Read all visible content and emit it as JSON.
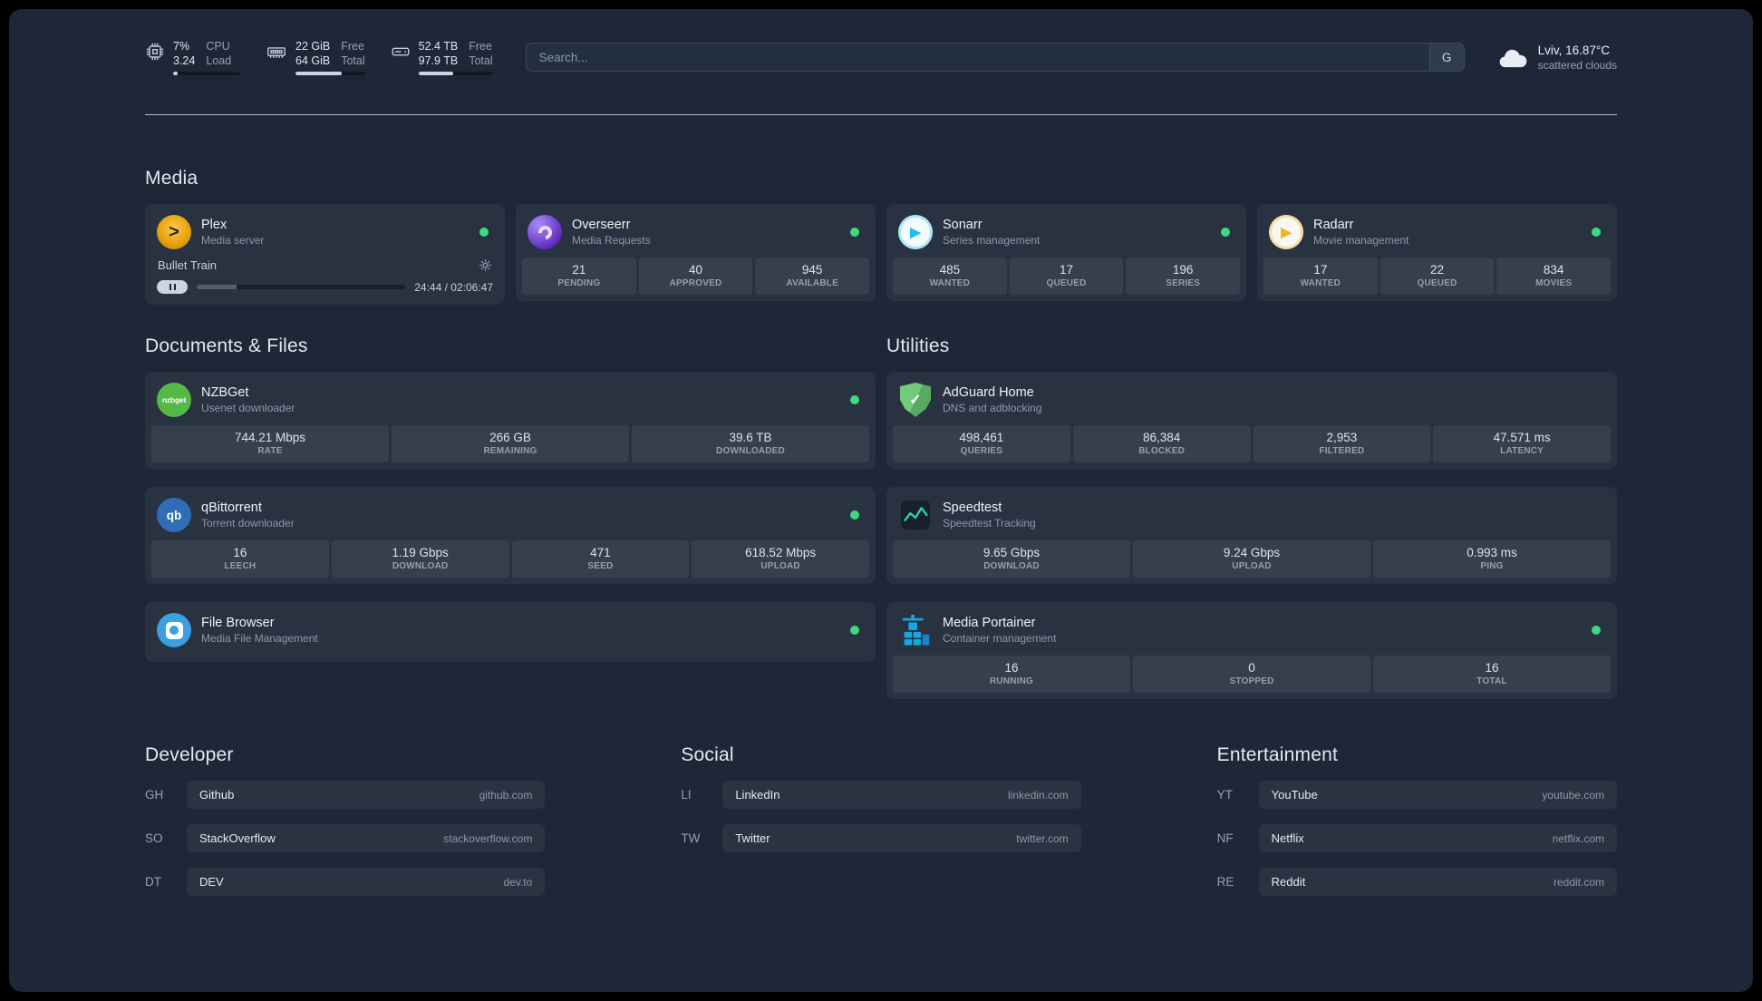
{
  "colors": {
    "status_online": "#3fd97f",
    "accent_green": "#2dd4a7"
  },
  "topbar": {
    "resources": [
      {
        "icon": "cpu-icon",
        "values": [
          "7%",
          "3.24"
        ],
        "labels": [
          "CPU",
          "Load"
        ],
        "progress": 7
      },
      {
        "icon": "memory-icon",
        "values": [
          "22 GiB",
          "64 GiB"
        ],
        "labels": [
          "Free",
          "Total"
        ],
        "progress": 66
      },
      {
        "icon": "disk-icon",
        "values": [
          "52.4 TB",
          "97.9 TB"
        ],
        "labels": [
          "Free",
          "Total"
        ],
        "progress": 47
      }
    ],
    "search": {
      "placeholder": "Search...",
      "provider_label": "G"
    },
    "weather": {
      "icon": "cloud-icon",
      "location": "Lviv, 16.87°C",
      "condition": "scattered clouds"
    }
  },
  "sections": {
    "media": {
      "title": "Media",
      "cards": [
        {
          "name": "Plex",
          "description": "Media server",
          "icon": "plex-icon",
          "status_color": "#3fd97f",
          "player": {
            "title": "Bullet Train",
            "time": "24:44 / 02:06:47",
            "progress": 19
          }
        },
        {
          "name": "Overseerr",
          "description": "Media Requests",
          "icon": "overseerr-icon",
          "status_color": "#3fd97f",
          "stats": [
            {
              "value": "21",
              "label": "PENDING"
            },
            {
              "value": "40",
              "label": "APPROVED"
            },
            {
              "value": "945",
              "label": "AVAILABLE"
            }
          ]
        },
        {
          "name": "Sonarr",
          "description": "Series management",
          "icon": "sonarr-icon",
          "status_color": "#3fd97f",
          "stats": [
            {
              "value": "485",
              "label": "WANTED"
            },
            {
              "value": "17",
              "label": "QUEUED"
            },
            {
              "value": "196",
              "label": "SERIES"
            }
          ]
        },
        {
          "name": "Radarr",
          "description": "Movie management",
          "icon": "radarr-icon",
          "status_color": "#3fd97f",
          "stats": [
            {
              "value": "17",
              "label": "WANTED"
            },
            {
              "value": "22",
              "label": "QUEUED"
            },
            {
              "value": "834",
              "label": "MOVIES"
            }
          ]
        }
      ]
    },
    "documents": {
      "title": "Documents & Files",
      "cards": [
        {
          "name": "NZBGet",
          "description": "Usenet downloader",
          "icon": "nzbget-icon",
          "status_color": "#3fd97f",
          "stats": [
            {
              "value": "744.21 Mbps",
              "label": "RATE"
            },
            {
              "value": "266 GB",
              "label": "REMAINING"
            },
            {
              "value": "39.6 TB",
              "label": "DOWNLOADED"
            }
          ]
        },
        {
          "name": "qBittorrent",
          "description": "Torrent downloader",
          "icon": "qbittorrent-icon",
          "status_color": "#3fd97f",
          "stats": [
            {
              "value": "16",
              "label": "LEECH"
            },
            {
              "value": "1.19 Gbps",
              "label": "DOWNLOAD"
            },
            {
              "value": "471",
              "label": "SEED"
            },
            {
              "value": "618.52 Mbps",
              "label": "UPLOAD"
            }
          ]
        },
        {
          "name": "File Browser",
          "description": "Media File Management",
          "icon": "filebrowser-icon",
          "status_color": "#3fd97f"
        }
      ]
    },
    "utilities": {
      "title": "Utilities",
      "cards": [
        {
          "name": "AdGuard Home",
          "description": "DNS and adblocking",
          "icon": "adguard-icon",
          "stats": [
            {
              "value": "498,461",
              "label": "QUERIES"
            },
            {
              "value": "86,384",
              "label": "BLOCKED"
            },
            {
              "value": "2,953",
              "label": "FILTERED"
            },
            {
              "value": "47.571 ms",
              "label": "LATENCY"
            }
          ]
        },
        {
          "name": "Speedtest",
          "description": "Speedtest Tracking",
          "icon": "speedtest-icon",
          "stats": [
            {
              "value": "9.65 Gbps",
              "label": "DOWNLOAD"
            },
            {
              "value": "9.24 Gbps",
              "label": "UPLOAD"
            },
            {
              "value": "0.993 ms",
              "label": "PING"
            }
          ]
        },
        {
          "name": "Media Portainer",
          "description": "Container management",
          "icon": "portainer-icon",
          "status_color": "#3fd97f",
          "stats": [
            {
              "value": "16",
              "label": "RUNNING"
            },
            {
              "value": "0",
              "label": "STOPPED"
            },
            {
              "value": "16",
              "label": "TOTAL"
            }
          ]
        }
      ]
    }
  },
  "bookmarks": [
    {
      "title": "Developer",
      "items": [
        {
          "abbr": "GH",
          "name": "Github",
          "url": "github.com"
        },
        {
          "abbr": "SO",
          "name": "StackOverflow",
          "url": "stackoverflow.com"
        },
        {
          "abbr": "DT",
          "name": "DEV",
          "url": "dev.to"
        }
      ]
    },
    {
      "title": "Social",
      "items": [
        {
          "abbr": "LI",
          "name": "LinkedIn",
          "url": "linkedin.com"
        },
        {
          "abbr": "TW",
          "name": "Twitter",
          "url": "twitter.com"
        }
      ]
    },
    {
      "title": "Entertainment",
      "items": [
        {
          "abbr": "YT",
          "name": "YouTube",
          "url": "youtube.com"
        },
        {
          "abbr": "NF",
          "name": "Netflix",
          "url": "netflix.com"
        },
        {
          "abbr": "RE",
          "name": "Reddit",
          "url": "reddit.com"
        }
      ]
    }
  ]
}
